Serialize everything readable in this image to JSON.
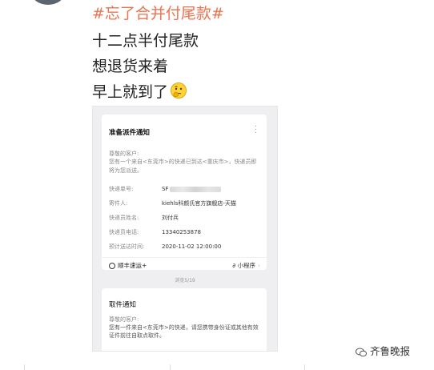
{
  "post": {
    "hashtag": "#忘了合并付尾款#",
    "lines": [
      "十二点半付尾款",
      "想退货来着",
      "早上就到了"
    ]
  },
  "screenshot": {
    "card1": {
      "title": "准备派件通知",
      "greeting": "尊敬的客户:",
      "body": "您有一个来自<东莞市>的快递已到达<重庆市>，快递员即将为您派送。",
      "rows": [
        {
          "label": "快递单号:",
          "value": "SF"
        },
        {
          "label": "寄件人:",
          "value": "kiehls科颜氏官方旗舰店-天猫"
        },
        {
          "label": "快递员姓名:",
          "value": "刘付兵"
        },
        {
          "label": "快递员电话:",
          "value": "13340253878"
        },
        {
          "label": "预计送达时间:",
          "value": "2020-11-02 12:00:00"
        }
      ],
      "service": "顺丰速运+",
      "mini_program": "小程序"
    },
    "browsed": "浏览5/19",
    "card2": {
      "title": "取件通知",
      "greeting": "尊敬的客户:",
      "body": "您有一件来自<东莞市>的快递，请您携带身份证或其他有效证件前往自取点取件。"
    }
  },
  "watermark": "齐鲁晚报",
  "colors": {
    "hashtag": "#eb7350",
    "page_bg": "#ffffff",
    "screenshot_bg": "#efeff1"
  }
}
